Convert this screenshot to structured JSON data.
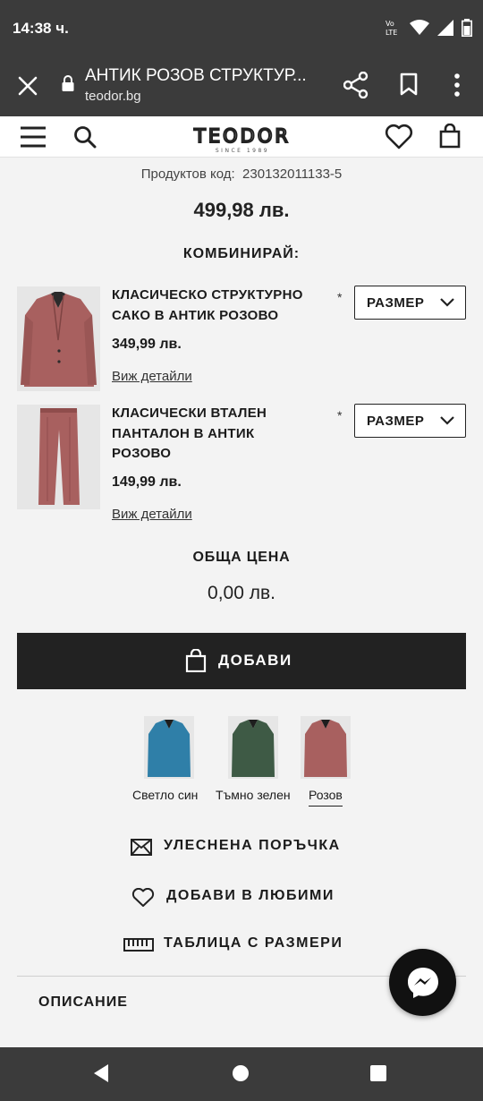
{
  "status_bar": {
    "time": "14:38 ч."
  },
  "browser": {
    "title": "АНТИК РОЗОВ СТРУКТУР...",
    "url": "teodor.bg"
  },
  "header": {
    "logo_text": "TEODOR",
    "logo_sub": "SINCE 1989"
  },
  "product": {
    "code_label": "Продуктов код:",
    "code_value": "230132011133-5",
    "price": "499,98 лв."
  },
  "combine": {
    "title": "КОМБИНИРАЙ:",
    "items": [
      {
        "name_line1": "КЛАСИЧЕСКО СТРУКТУРНО",
        "name_line2": "САКО В АНТИК РОЗОВО",
        "price": "349,99 лв.",
        "details_link": "Виж детайли",
        "required_mark": "*",
        "size_label": "РАЗМЕР"
      },
      {
        "name_line1": "КЛАСИЧЕСКИ ВТАЛЕН",
        "name_line2": "ПАНТАЛОН В АНТИК",
        "name_line3": "РОЗОВО",
        "price": "149,99 лв.",
        "details_link": "Виж детайли",
        "required_mark": "*",
        "size_label": "РАЗМЕР"
      }
    ]
  },
  "total": {
    "label": "ОБЩА ЦЕНА",
    "value": "0,00 лв."
  },
  "add_button": {
    "label": "ДОБАВИ"
  },
  "colors": {
    "swatches": [
      {
        "label": "Светло син",
        "color": "#2f7fa8"
      },
      {
        "label": "Тъмно зелен",
        "color": "#3e5a45"
      },
      {
        "label": "Розов",
        "color": "#a8605f",
        "selected": true
      }
    ]
  },
  "actions": {
    "easy_order": "УЛЕСНЕНА ПОРЪЧКА",
    "add_favorite": "ДОБАВИ В ЛЮБИМИ",
    "size_table": "ТАБЛИЦА С РАЗМЕРИ"
  },
  "description": {
    "title": "ОПИСАНИЕ"
  },
  "theme": {
    "dark": "#222222",
    "bar": "#3b3b3b",
    "bg": "#f3f3f3",
    "product_pink": "#a8605f"
  }
}
